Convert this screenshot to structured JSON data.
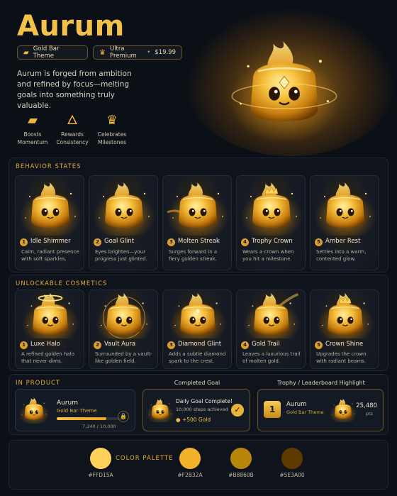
{
  "hero": {
    "title": "Aurum",
    "badge_theme": "Gold Bar Theme",
    "badge_premium": "Ultra Premium",
    "badge_price": "$19.99",
    "description": "Aurum is forged from ambition and refined by focus—melting goals into something truly valuable.",
    "perks": [
      {
        "icon": "gold-bar-icon",
        "label": "Boosts Momentum"
      },
      {
        "icon": "flame-icon",
        "label": "Rewards Consistency"
      },
      {
        "icon": "crown-icon",
        "label": "Celebrates Milestones"
      }
    ]
  },
  "behavior": {
    "heading": "BEHAVIOR STATES",
    "items": [
      {
        "num": "1",
        "title": "Idle Shimmer",
        "desc": "Calm, radiant presence with soft sparkles."
      },
      {
        "num": "2",
        "title": "Goal Glint",
        "desc": "Eyes brighten—your progress just glinted."
      },
      {
        "num": "3",
        "title": "Molten Streak",
        "desc": "Surges forward in a fiery golden streak."
      },
      {
        "num": "4",
        "title": "Trophy Crown",
        "desc": "Wears a crown when you hit a milestone."
      },
      {
        "num": "5",
        "title": "Amber Rest",
        "desc": "Settles into a warm, contented glow."
      }
    ]
  },
  "cosmetics": {
    "heading": "UNLOCKABLE COSMETICS",
    "items": [
      {
        "num": "1",
        "title": "Luxe Halo",
        "desc": "A refined golden halo that never dims."
      },
      {
        "num": "2",
        "title": "Vault Aura",
        "desc": "Surrounded by a vault-like golden field."
      },
      {
        "num": "3",
        "title": "Diamond Glint",
        "desc": "Adds a subtle diamond spark to the crest."
      },
      {
        "num": "4",
        "title": "Gold Trail",
        "desc": "Leaves a luxurious trail of molten gold."
      },
      {
        "num": "5",
        "title": "Crown Shine",
        "desc": "Upgrades the crown with radiant beams."
      }
    ]
  },
  "product": {
    "heading": "IN PRODUCT",
    "profile": {
      "name": "Aurum",
      "theme": "Gold Bar Theme",
      "progress_text": "7,240 / 10,000",
      "progress": 0.724
    },
    "completed": {
      "label": "Completed Goal",
      "title": "Daily Goal Complete!",
      "sub": "10,000 steps achieved",
      "reward": "+500 Gold"
    },
    "trophy": {
      "label": "Trophy / Leaderboard Highlight",
      "rank": "1",
      "name": "Aurum",
      "theme": "Gold Bar Theme",
      "points": "25,480",
      "unit": "pts"
    }
  },
  "palette": {
    "heading": "COLOR PALETTE",
    "colors": [
      "#FFD15A",
      "#F2B32A",
      "#B8860B",
      "#5E3A00"
    ]
  }
}
